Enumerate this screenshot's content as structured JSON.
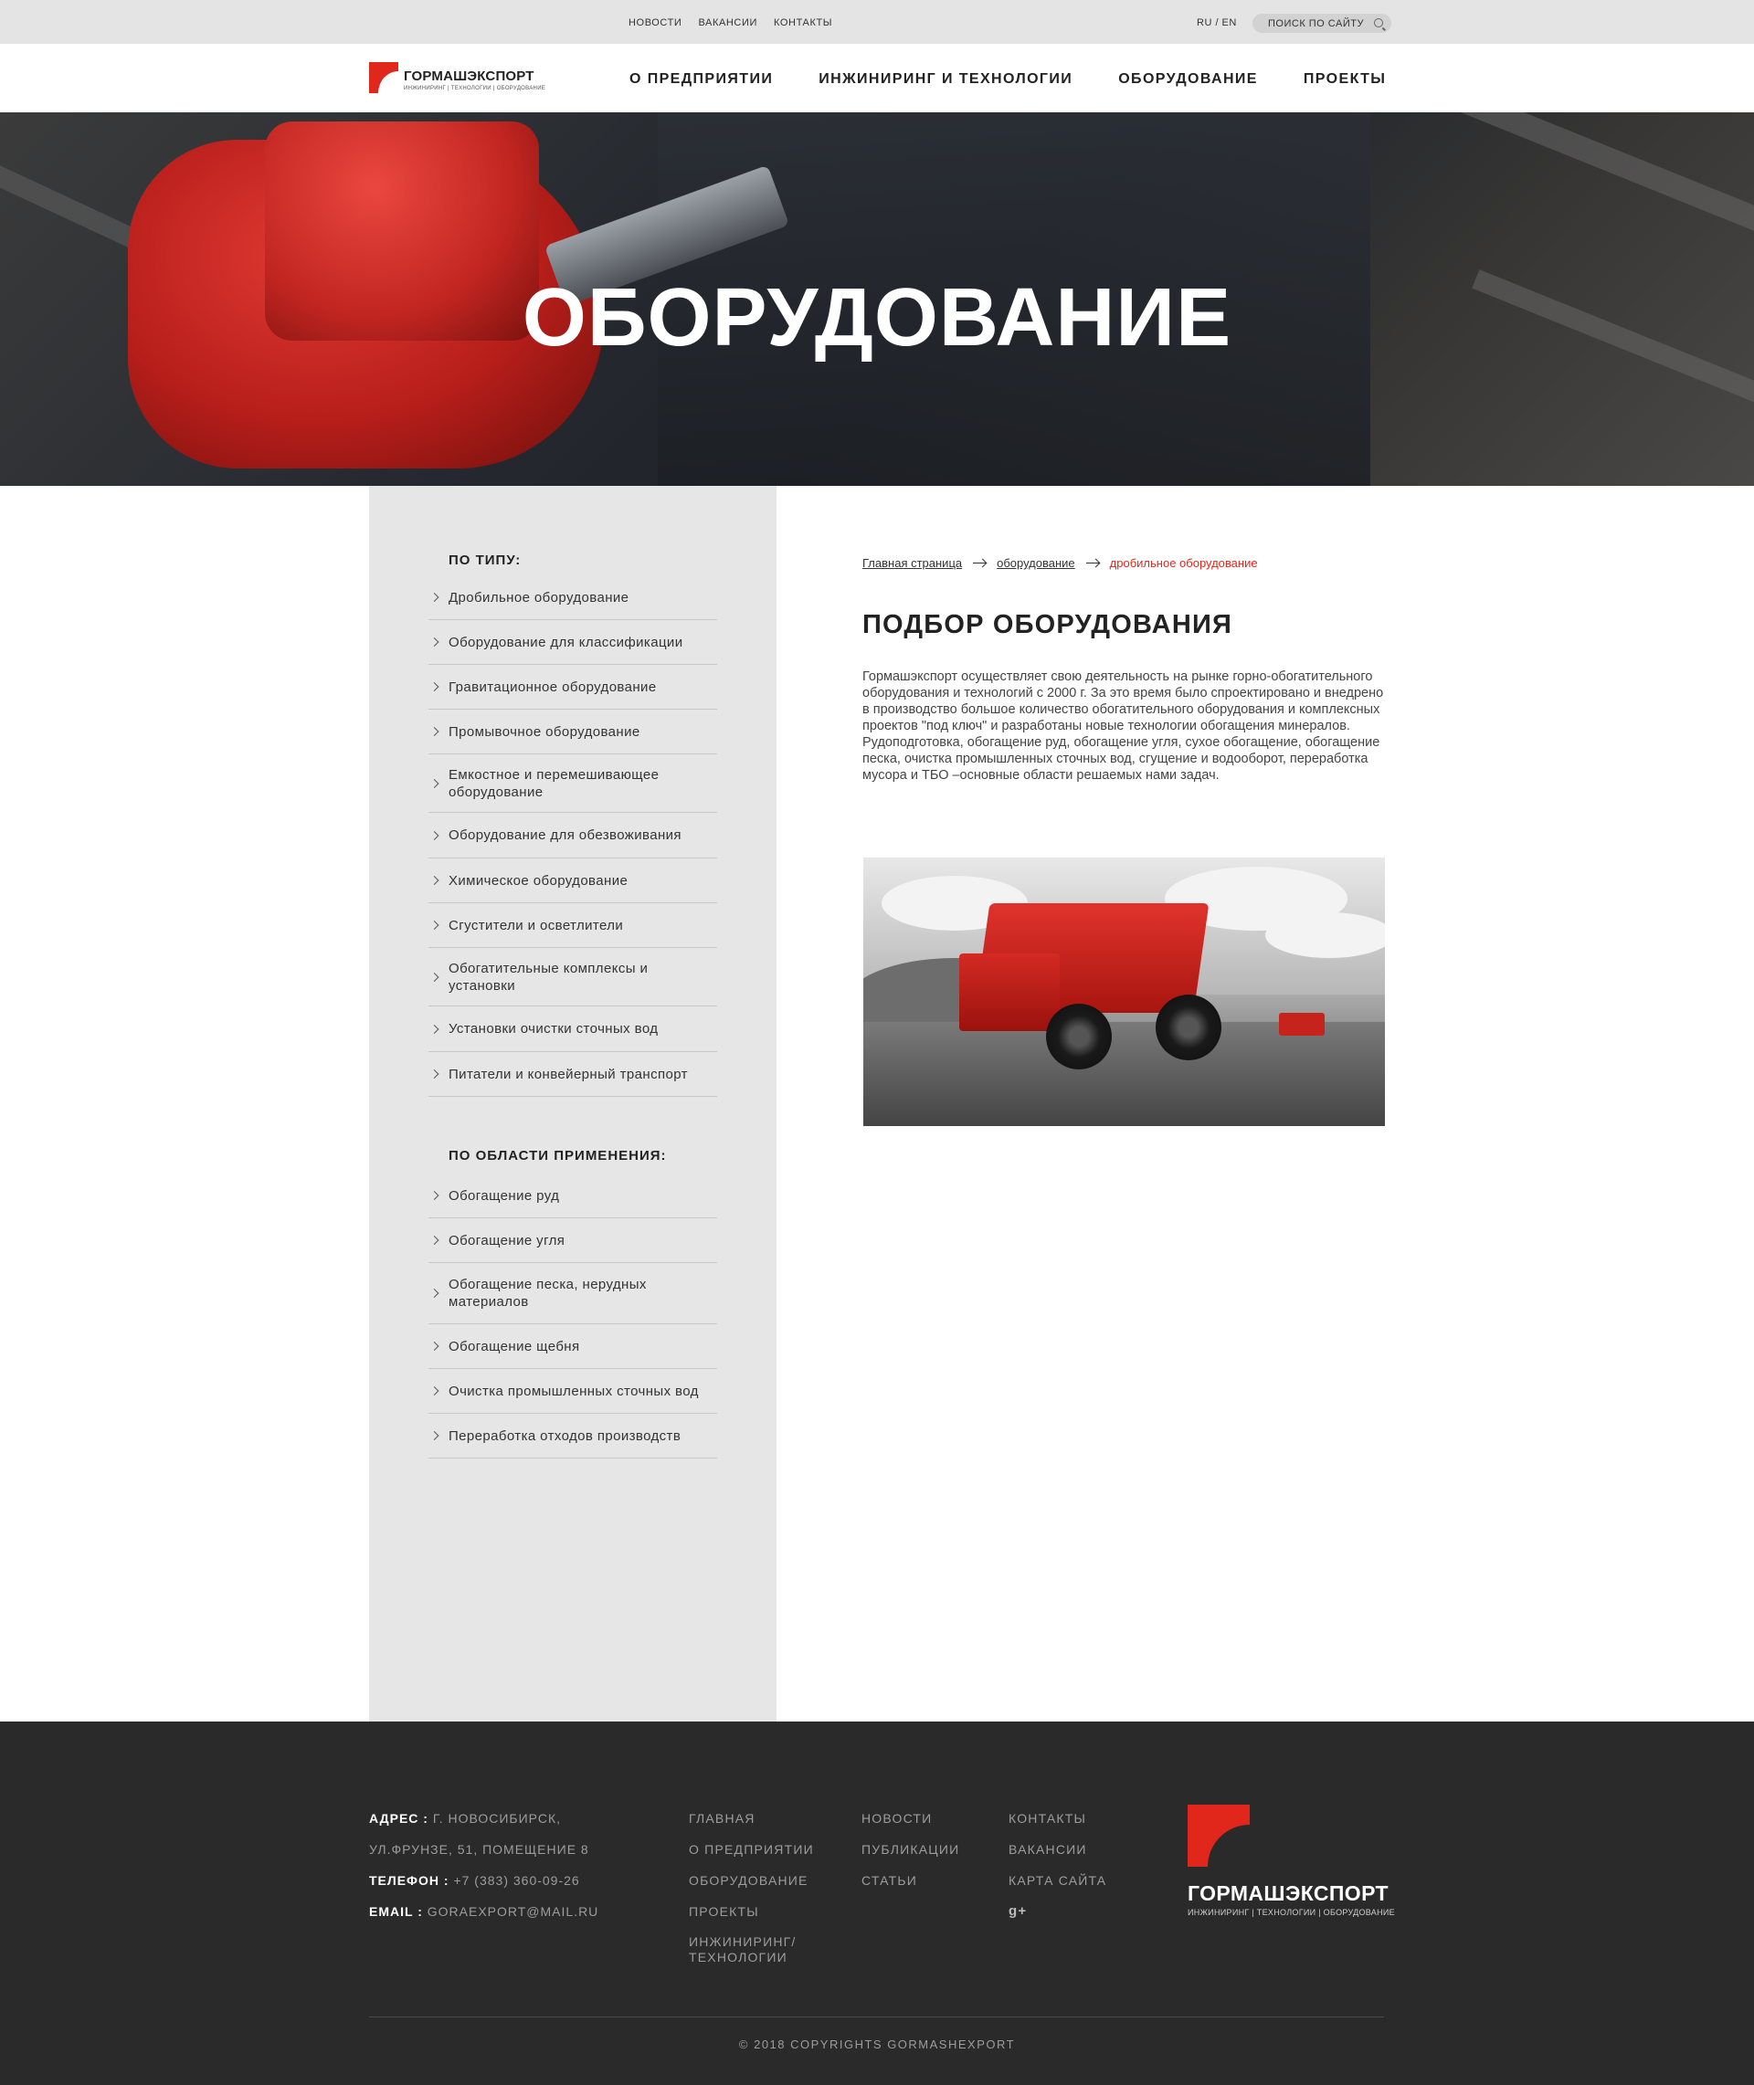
{
  "topbar": {
    "links": [
      "НОВОСТИ",
      "ВАКАНСИИ",
      "КОНТАКТЫ"
    ],
    "lang": "RU / EN",
    "search_label": "ПОИСК ПО САЙТУ"
  },
  "logo": {
    "name": "ГОРМАШЭКСПОРТ",
    "tagline": "ИНЖИНИРИНГ | ТЕХНОЛОГИИ | ОБОРУДОВАНИЕ"
  },
  "nav": {
    "items": [
      "О ПРЕДПРИЯТИИ",
      "ИНЖИНИРИНГ И ТЕХНОЛОГИИ",
      "ОБОРУДОВАНИЕ",
      "ПРОЕКТЫ"
    ],
    "active": "ОБОРУДОВАНИЕ"
  },
  "hero": {
    "title": "ОБОРУДОВАНИЕ"
  },
  "sidebar": {
    "by_type_title": "ПО ТИПУ:",
    "by_type": [
      "Дробильное оборудование",
      "Оборудование для классификации",
      "Гравитационное оборудование",
      "Промывочное оборудование",
      "Емкостное и перемешивающее оборудование",
      "Оборудование для обезвоживания",
      "Химическое оборудование",
      "Сгустители и осветлители",
      "Обогатительные комплексы и установки",
      "Установки очистки сточных вод",
      "Питатели и конвейерный транспорт"
    ],
    "by_area_title": "ПО ОБЛАСТИ ПРИМЕНЕНИЯ:",
    "by_area": [
      "Обогащение руд",
      "Обогащение угля",
      "Обогащение песка, нерудных материалов",
      "Обогащение щебня",
      "Очистка промышленных сточных вод",
      "Переработка отходов производств"
    ]
  },
  "breadcrumb": {
    "home": "Главная страница",
    "section": "оборудование",
    "current": "дробильное оборудование"
  },
  "content": {
    "title": "ПОДБОР ОБОРУДОВАНИЯ",
    "text": "Гормашэкспорт осуществляет свою деятельность на рынке горно-обогатительного оборудования и технологий с 2000 г. За это время было спроектировано и внедрено в производство большое количество обогатительного оборудования и комплексных проектов \"под ключ\" и разработаны новые технологии обогащения минералов. Рудоподготовка, обогащение руд, обогащение угля, сухое обогащение, обогащение песка, очистка промышленных сточных вод, сгущение и водооборот, переработка мусора и ТБО –основные области решаемых нами задач."
  },
  "footer": {
    "address_label": "АДРЕС :",
    "address_line1": "Г. НОВОСИБИРСК,",
    "address_line2": "УЛ.ФРУНЗЕ, 51, ПОМЕЩЕНИЕ 8",
    "phone_label": "ТЕЛЕФОН :",
    "phone": "+7 (383) 360-09-26",
    "email_label": "EMAIL :",
    "email": "GORAEXPORT@MAIL.RU",
    "col1": [
      "ГЛАВНАЯ",
      "О ПРЕДПРИЯТИИ",
      "ОБОРУДОВАНИЕ",
      "ПРОЕКТЫ",
      "ИНЖИНИРИНГ/ ТЕХНОЛОГИИ"
    ],
    "col2": [
      "НОВОСТИ",
      "ПУБЛИКАЦИИ",
      "СТАТЬИ"
    ],
    "col3": [
      "КОНТАКТЫ",
      "ВАКАНСИИ",
      "КАРТА САЙТА"
    ],
    "gplus": "g+",
    "copyright": "© 2018 COPYRIGHTS GORMASHEXPORT"
  },
  "colors": {
    "accent": "#e1261c",
    "footer_bg": "#2a2a2a",
    "sidebar_bg": "#e6e6e6"
  },
  "icons": [
    "search-icon",
    "chevron-right-icon",
    "arrow-right-icon",
    "google-plus-icon"
  ]
}
